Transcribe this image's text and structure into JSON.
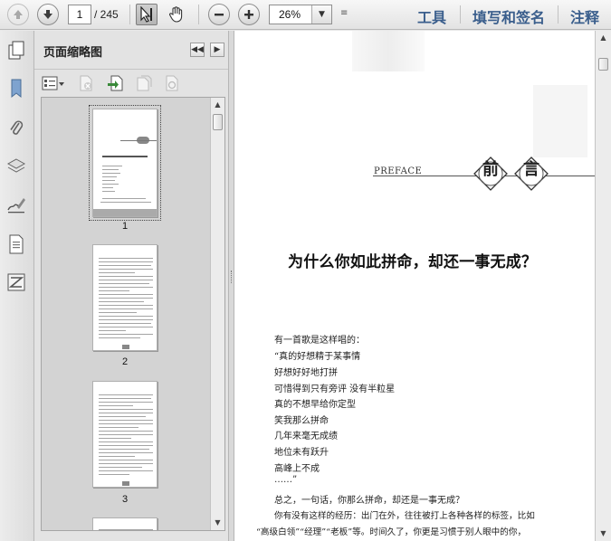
{
  "toolbar": {
    "current_page": "1",
    "page_total": "/ 245",
    "zoom": "26%",
    "tools_label": "工具",
    "fill_sign_label": "填写和签名",
    "comment_label": "注释"
  },
  "panel": {
    "title": "页面缩略图",
    "thumbnails": [
      {
        "page": "1"
      },
      {
        "page": "2"
      },
      {
        "page": "3"
      }
    ]
  },
  "document": {
    "preface_label": "PREFACE",
    "emblem_chars": [
      "前",
      "言"
    ],
    "title": "为什么你如此拼命，却还一事无成？",
    "lines": [
      "有一首歌是这样唱的：",
      "“真的好想精于某事情",
      "好想好好地打拼",
      "可惜得到只有旁评   没有半粒星",
      "真的不想早给你定型",
      "笑我那么拼命",
      "几年来毫无成绩",
      "地位未有跃升",
      "高峰上不成",
      "……”",
      "总之，一句话，你那么拼命，却还是一事无成？",
      "你有没有这样的经历：出门在外，往往被打上各种各样的标签，比如",
      "“高级白领”“经理”“老板”等。时间久了，你更是习惯于别人眼中的你，"
    ]
  },
  "colors": {
    "link": "#3a5e8c",
    "toolbar_bg": "#eeeeee",
    "panel_bg": "#e3e3e3"
  },
  "icons": {
    "toolbar": [
      "prev-page-icon",
      "next-page-icon",
      "select-cursor-icon",
      "hand-tool-icon",
      "zoom-out-icon",
      "zoom-in-icon",
      "dropdown-icon",
      "toolbar-menu-icon"
    ],
    "rail": [
      "bookmark-icon",
      "paperclip-icon",
      "layers-icon",
      "signature-icon",
      "page-content-icon",
      "compare-icon"
    ],
    "panel": [
      "thumbnail-options-icon",
      "delete-page-icon",
      "insert-page-icon",
      "extract-page-icon",
      "replace-page-icon"
    ]
  }
}
